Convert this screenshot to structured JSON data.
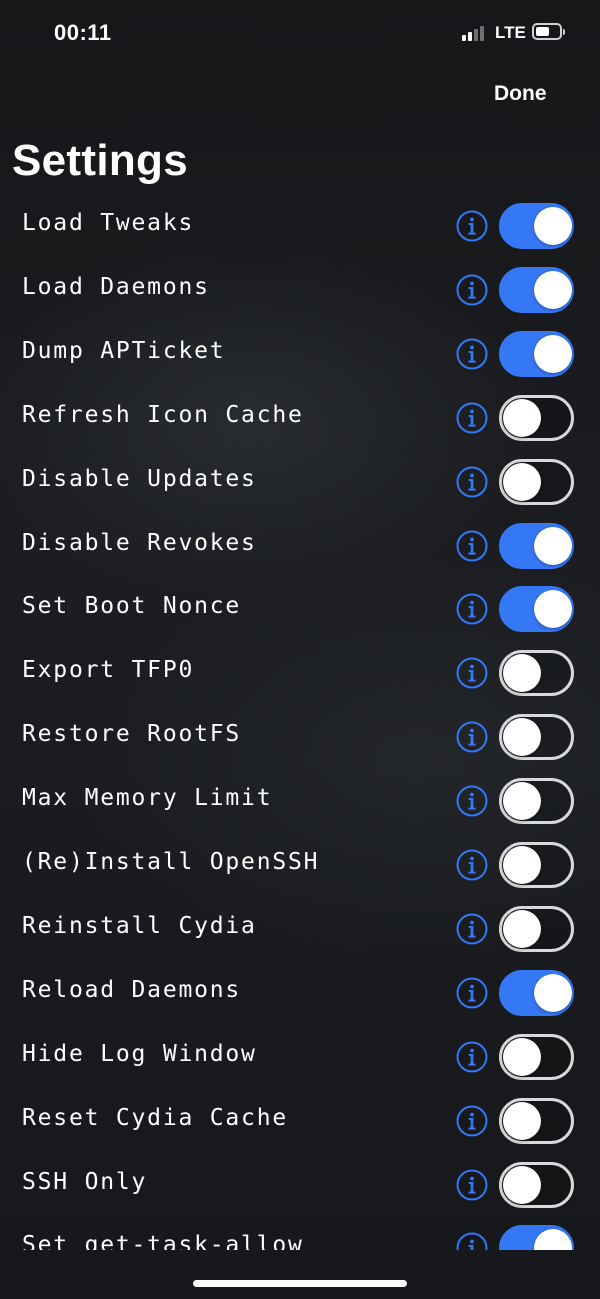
{
  "status_bar": {
    "time": "00:11",
    "network": "LTE",
    "signal_bars_active": 2,
    "signal_bars_total": 4,
    "battery_level": 0.6
  },
  "nav": {
    "done_label": "Done"
  },
  "title": "Settings",
  "colors": {
    "accent": "#3478f6",
    "background": "#141619",
    "text": "#ffffff"
  },
  "settings": [
    {
      "label": "Load Tweaks",
      "on": true
    },
    {
      "label": "Load Daemons",
      "on": true
    },
    {
      "label": "Dump APTicket",
      "on": true
    },
    {
      "label": "Refresh Icon Cache",
      "on": false
    },
    {
      "label": "Disable Updates",
      "on": false
    },
    {
      "label": "Disable Revokes",
      "on": true
    },
    {
      "label": "Set Boot Nonce",
      "on": true
    },
    {
      "label": "Export TFP0",
      "on": false
    },
    {
      "label": "Restore RootFS",
      "on": false
    },
    {
      "label": "Max Memory Limit",
      "on": false
    },
    {
      "label": "(Re)Install OpenSSH",
      "on": false
    },
    {
      "label": "Reinstall Cydia",
      "on": false
    },
    {
      "label": "Reload Daemons",
      "on": true
    },
    {
      "label": "Hide Log Window",
      "on": false
    },
    {
      "label": "Reset Cydia Cache",
      "on": false
    },
    {
      "label": "SSH Only",
      "on": false
    },
    {
      "label": "Set get-task-allow",
      "on": true
    }
  ]
}
